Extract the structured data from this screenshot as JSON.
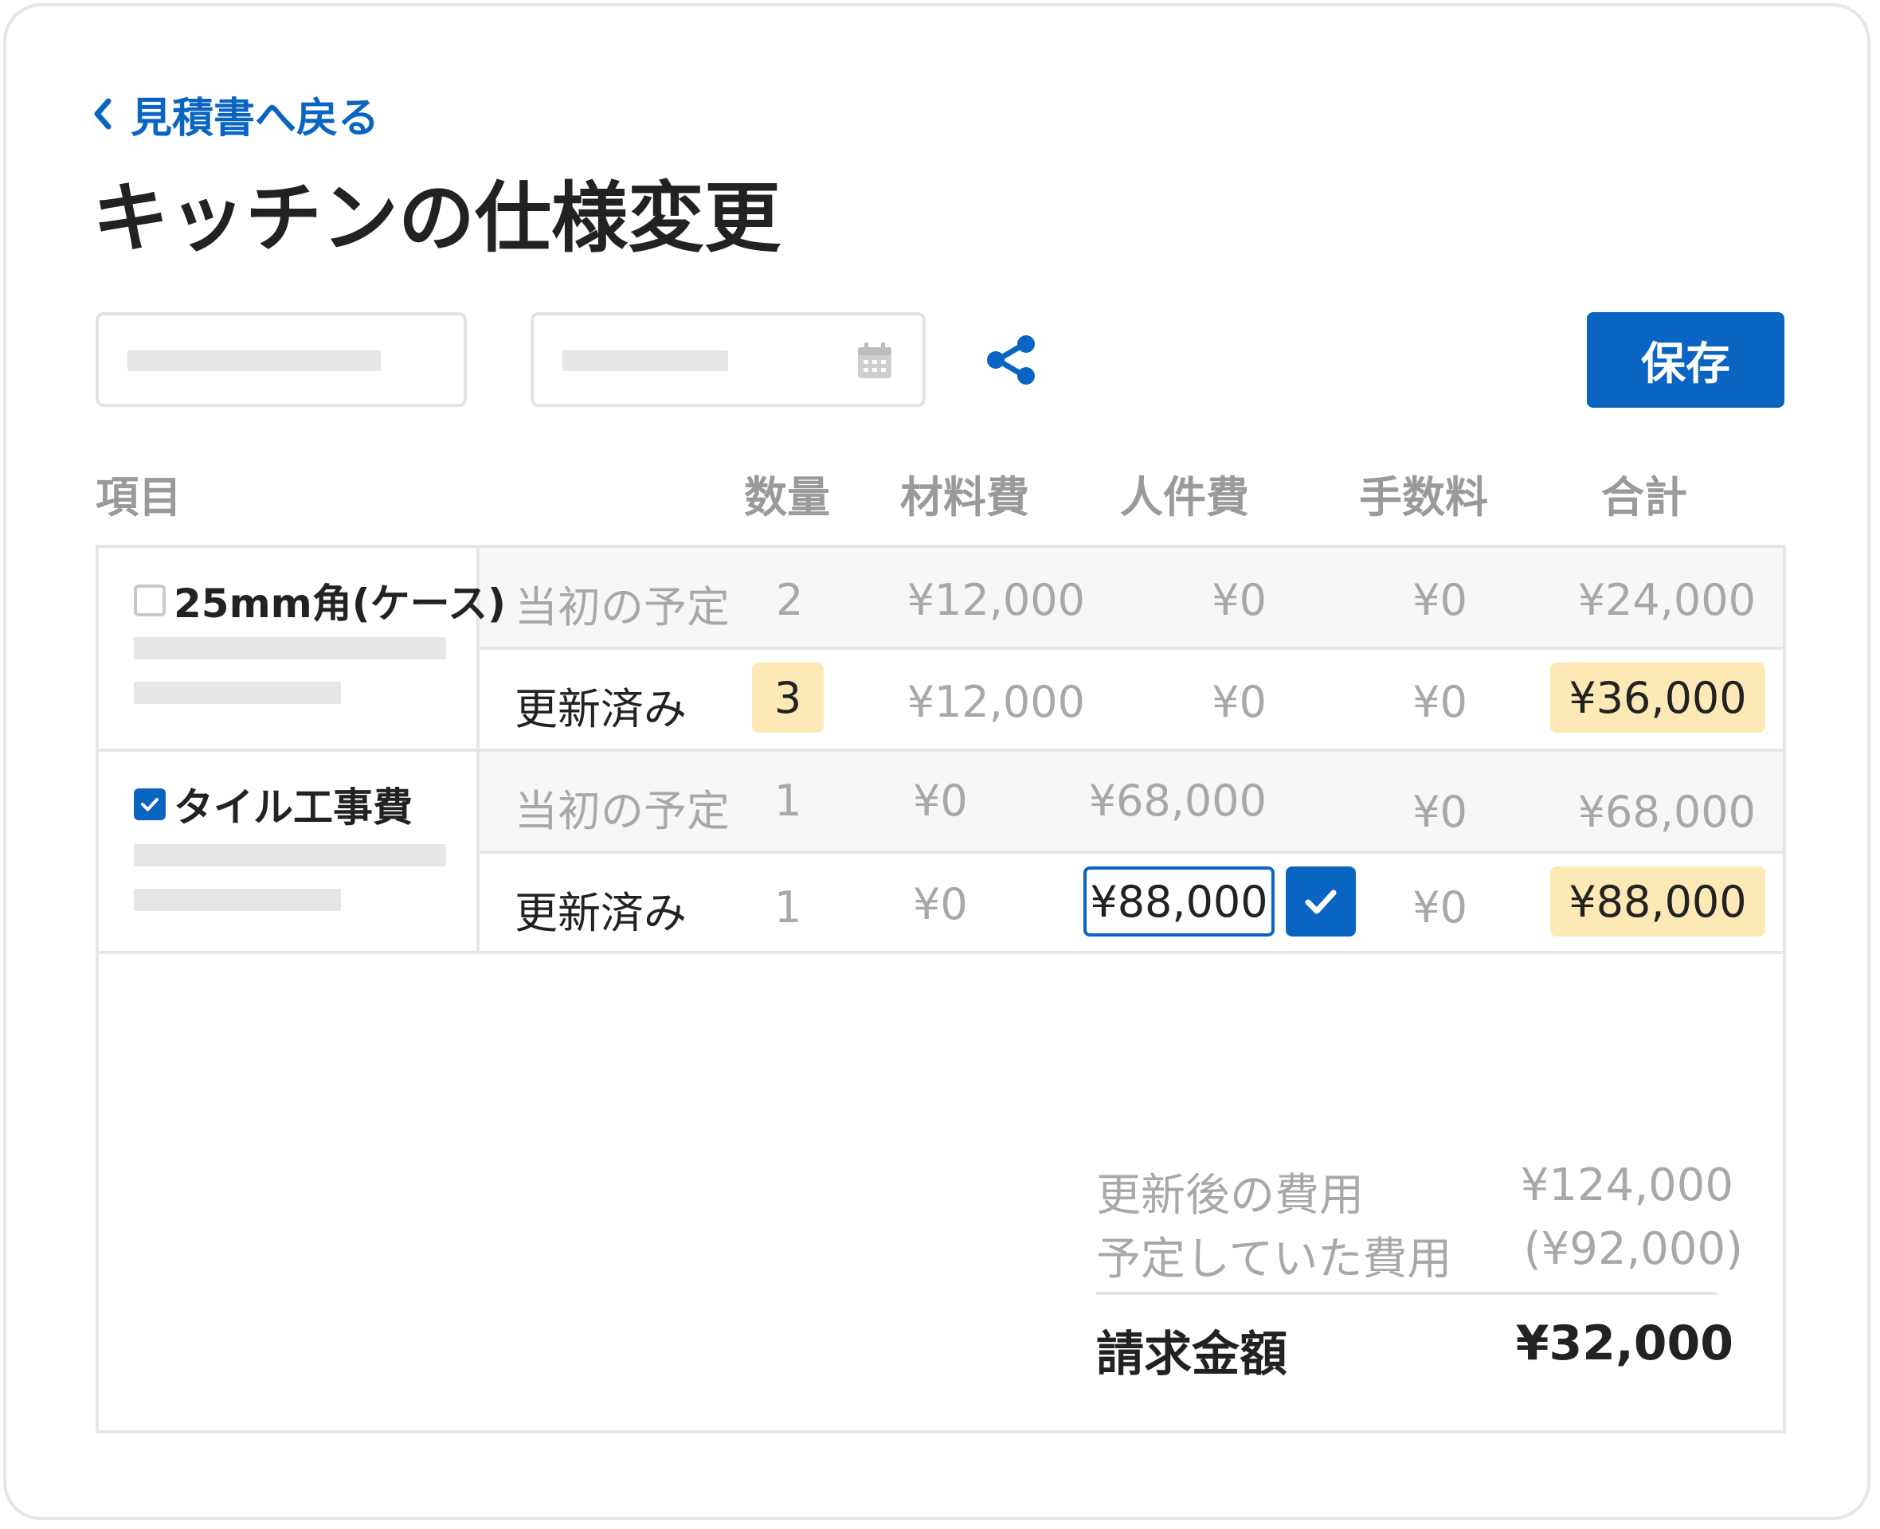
{
  "header": {
    "back_label": "見積書へ戻る",
    "title": "キッチンの仕様変更"
  },
  "toolbar": {
    "save_label": "保存"
  },
  "columns": {
    "item": "項目",
    "qty": "数量",
    "material": "材料費",
    "labor": "人件費",
    "fee": "手数料",
    "total": "合計"
  },
  "rows": [
    {
      "name": "25mm角(ケース)",
      "checked": false,
      "planned": {
        "label": "当初の予定",
        "qty": "2",
        "material": "¥12,000",
        "labor": "¥0",
        "fee": "¥0",
        "total": "¥24,000"
      },
      "updated": {
        "label": "更新済み",
        "qty": "3",
        "material": "¥12,000",
        "labor": "¥0",
        "fee": "¥0",
        "total": "¥36,000"
      }
    },
    {
      "name": "タイル工事費",
      "checked": true,
      "planned": {
        "label": "当初の予定",
        "qty": "1",
        "material": "¥0",
        "labor": "¥68,000",
        "fee": "¥0",
        "total": "¥68,000"
      },
      "updated": {
        "label": "更新済み",
        "qty": "1",
        "material": "¥0",
        "labor": "¥88,000",
        "fee": "¥0",
        "total": "¥88,000"
      }
    }
  ],
  "summary": {
    "updated_cost_label": "更新後の費用",
    "updated_cost_value": "¥124,000",
    "planned_cost_label": "予定していた費用",
    "planned_cost_value": "(¥92,000)",
    "billing_label": "請求金額",
    "billing_value": "¥32,000"
  },
  "colors": {
    "accent": "#0a64c2",
    "highlight": "#fde9b6",
    "border": "#e6e6e6"
  }
}
